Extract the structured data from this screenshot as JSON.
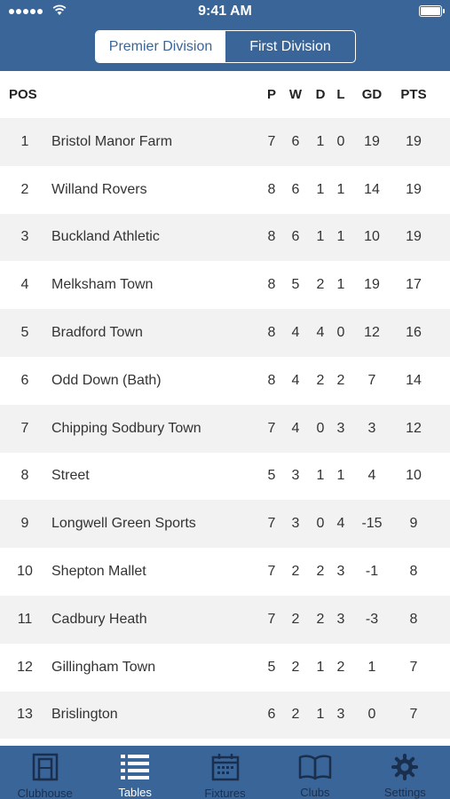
{
  "status_bar": {
    "time": "9:41 AM"
  },
  "segmented": {
    "options": [
      "Premier Division",
      "First Division"
    ],
    "selected": "Premier Division"
  },
  "table": {
    "headers": {
      "pos": "POS",
      "p": "P",
      "w": "W",
      "d": "D",
      "l": "L",
      "gd": "GD",
      "pts": "PTS"
    },
    "rows": [
      {
        "pos": "1",
        "team": "Bristol Manor Farm",
        "p": "7",
        "w": "6",
        "d": "1",
        "l": "0",
        "gd": "19",
        "pts": "19"
      },
      {
        "pos": "2",
        "team": "Willand Rovers",
        "p": "8",
        "w": "6",
        "d": "1",
        "l": "1",
        "gd": "14",
        "pts": "19"
      },
      {
        "pos": "3",
        "team": "Buckland Athletic",
        "p": "8",
        "w": "6",
        "d": "1",
        "l": "1",
        "gd": "10",
        "pts": "19"
      },
      {
        "pos": "4",
        "team": "Melksham Town",
        "p": "8",
        "w": "5",
        "d": "2",
        "l": "1",
        "gd": "19",
        "pts": "17"
      },
      {
        "pos": "5",
        "team": "Bradford Town",
        "p": "8",
        "w": "4",
        "d": "4",
        "l": "0",
        "gd": "12",
        "pts": "16"
      },
      {
        "pos": "6",
        "team": "Odd Down (Bath)",
        "p": "8",
        "w": "4",
        "d": "2",
        "l": "2",
        "gd": "7",
        "pts": "14"
      },
      {
        "pos": "7",
        "team": "Chipping Sodbury Town",
        "p": "7",
        "w": "4",
        "d": "0",
        "l": "3",
        "gd": "3",
        "pts": "12"
      },
      {
        "pos": "8",
        "team": "Street",
        "p": "5",
        "w": "3",
        "d": "1",
        "l": "1",
        "gd": "4",
        "pts": "10"
      },
      {
        "pos": "9",
        "team": "Longwell Green Sports",
        "p": "7",
        "w": "3",
        "d": "0",
        "l": "4",
        "gd": "-15",
        "pts": "9"
      },
      {
        "pos": "10",
        "team": "Shepton Mallet",
        "p": "7",
        "w": "2",
        "d": "2",
        "l": "3",
        "gd": "-1",
        "pts": "8"
      },
      {
        "pos": "11",
        "team": "Cadbury Heath",
        "p": "7",
        "w": "2",
        "d": "2",
        "l": "3",
        "gd": "-3",
        "pts": "8"
      },
      {
        "pos": "12",
        "team": "Gillingham Town",
        "p": "5",
        "w": "2",
        "d": "1",
        "l": "2",
        "gd": "1",
        "pts": "7"
      },
      {
        "pos": "13",
        "team": "Brislington",
        "p": "6",
        "w": "2",
        "d": "1",
        "l": "3",
        "gd": "0",
        "pts": "7"
      }
    ]
  },
  "tabbar": {
    "items": [
      {
        "label": "Clubhouse",
        "icon": "clubhouse-icon"
      },
      {
        "label": "Tables",
        "icon": "list-icon"
      },
      {
        "label": "Fixtures",
        "icon": "calendar-icon"
      },
      {
        "label": "Clubs",
        "icon": "book-icon"
      },
      {
        "label": "Settings",
        "icon": "gear-icon"
      }
    ],
    "active": "Tables"
  },
  "colors": {
    "brand": "#3a6599",
    "row_alt": "#f2f2f2",
    "tab_inactive_label": "#1a2f4d"
  }
}
